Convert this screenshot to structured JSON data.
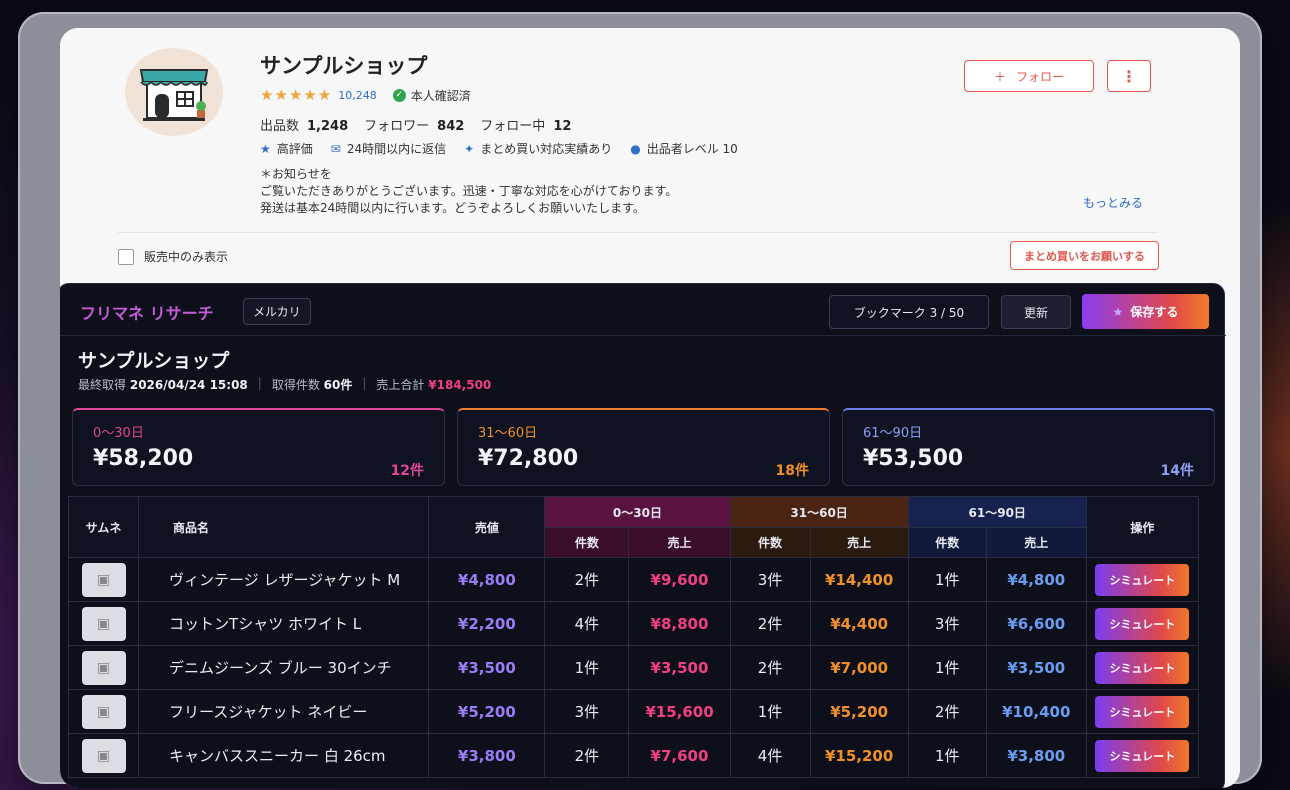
{
  "shop": {
    "name": "サンプルショップ",
    "stars": "★★★★★",
    "review_count": "10,248",
    "verified_label": "本人確認済",
    "stats": [
      {
        "label": "出品数",
        "value": "1,248"
      },
      {
        "label": "フォロワー",
        "value": "842"
      },
      {
        "label": "フォロー中",
        "value": "12"
      }
    ],
    "badges": [
      {
        "icon": "star-icon",
        "glyph": "★",
        "label": "高評価"
      },
      {
        "icon": "chat-icon",
        "glyph": "✉",
        "label": "24時間以内に返信"
      },
      {
        "icon": "package-icon",
        "glyph": "✦",
        "label": "まとめ買い対応実績あり"
      },
      {
        "icon": "medal-icon",
        "glyph": "●",
        "label": "出品者レベル 10"
      }
    ],
    "notice": [
      "＊お知らせを",
      "ご覧いただきありがとうございます。迅速・丁寧な対応を心がけております。",
      "発送は基本24時間以内に行います。どうぞよろしくお願いいたします。"
    ],
    "more_label": "もっとみる",
    "follow_label": "フォロー",
    "follow_plus": "＋",
    "kebab": "⋮",
    "filter_label": "販売中のみ表示",
    "bulk_label": "まとめ買いをお願いする"
  },
  "panel": {
    "brand": "フリマネ リサーチ",
    "platform": "メルカリ",
    "bookmark_label": "ブックマーク 3 / 50",
    "refresh_label": "更新",
    "save_label": "保存する",
    "shop_title": "サンプルショップ",
    "meta": {
      "last_fetch_label": "最終取得",
      "last_fetch_value": "2026/04/24 15:08",
      "count_label": "取得件数",
      "count_value": "60件",
      "total_label": "売上合計",
      "total_value": "¥184,500"
    },
    "cards": [
      {
        "range": "0〜30日",
        "amount": "¥58,200",
        "count": "12件"
      },
      {
        "range": "31〜60日",
        "amount": "¥72,800",
        "count": "18件"
      },
      {
        "range": "61〜90日",
        "amount": "¥53,500",
        "count": "14件"
      }
    ]
  },
  "table": {
    "headers": {
      "thumb": "サムネ",
      "name": "商品名",
      "price": "売値",
      "g1": "0〜30日",
      "g2": "31〜60日",
      "g3": "61〜90日",
      "count": "件数",
      "sales": "売上",
      "action": "操作"
    },
    "sim_label": "シミュレート",
    "rows": [
      {
        "name": "ヴィンテージ レザージャケット M",
        "price": "¥4,800",
        "c1": "2件",
        "s1": "¥9,600",
        "c2": "3件",
        "s2": "¥14,400",
        "c3": "1件",
        "s3": "¥4,800"
      },
      {
        "name": "コットンTシャツ ホワイト L",
        "price": "¥2,200",
        "c1": "4件",
        "s1": "¥8,800",
        "c2": "2件",
        "s2": "¥4,400",
        "c3": "3件",
        "s3": "¥6,600"
      },
      {
        "name": "デニムジーンズ ブルー 30インチ",
        "price": "¥3,500",
        "c1": "1件",
        "s1": "¥3,500",
        "c2": "2件",
        "s2": "¥7,000",
        "c3": "1件",
        "s3": "¥3,500"
      },
      {
        "name": "フリースジャケット ネイビー",
        "price": "¥5,200",
        "c1": "3件",
        "s1": "¥15,600",
        "c2": "1件",
        "s2": "¥5,200",
        "c3": "2件",
        "s3": "¥10,400"
      },
      {
        "name": "キャンバススニーカー 白 26cm",
        "price": "¥3,800",
        "c1": "2件",
        "s1": "¥7,600",
        "c2": "4件",
        "s2": "¥15,200",
        "c3": "1件",
        "s3": "¥3,800"
      }
    ]
  },
  "colors": {
    "accent_pink": "#f0407f",
    "accent_orange": "#f0902a",
    "accent_blue": "#6a9cf0",
    "accent_purple": "#9b7cf5"
  }
}
